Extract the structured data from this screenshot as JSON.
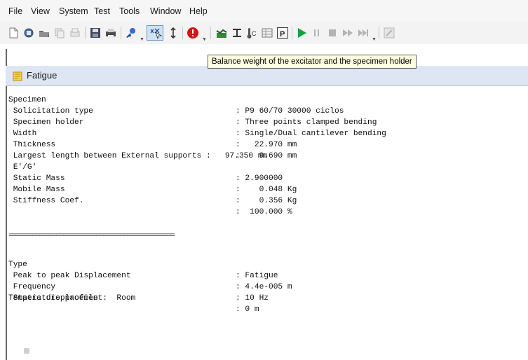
{
  "menu": [
    "File",
    "View",
    "System",
    "Test",
    "Tools",
    "Window",
    "Help"
  ],
  "toolbar": {
    "icons": [
      "new-icon",
      "open-icon",
      "browse-icon",
      "copy-icon",
      "print-preview-icon",
      "save-icon",
      "print-icon",
      "key-icon",
      "balance-weight-icon",
      "vertical-arrows-icon",
      "stop-icon",
      "chart-icon",
      "measure-icon",
      "temperature-icon",
      "table-icon",
      "parameters-icon",
      "play-icon",
      "pause-icon",
      "stop-square-icon",
      "fast-forward-icon",
      "skip-end-icon",
      "export-icon"
    ],
    "colors": {
      "stop": "#d21515",
      "play": "#14a33c",
      "chart": "#2d8a3a"
    }
  },
  "tooltip": "Balance weight of the excitator and the specimen holder",
  "window": {
    "title": "Fatigue"
  },
  "report": {
    "specimen": {
      "heading": "Specimen",
      "value": ": P9 60/70 30000 ciclos",
      "rows": [
        {
          "label": " Solicitation type",
          "value": ": Three points clamped bending"
        },
        {
          "label": " Specimen holder",
          "value": ": Single/Dual cantilever bending"
        },
        {
          "label": " Width",
          "value": ":   22.970 mm"
        },
        {
          "label": " Thickness",
          "value": ":    9.690 mm"
        },
        {
          "label": " Largest length between External supports :   97.350 mm",
          "value": ""
        },
        {
          "label": " E'/G'",
          "value": ": 2.900000"
        },
        {
          "label": " Static Mass",
          "value": ":    0.048 Kg"
        },
        {
          "label": " Mobile Mass",
          "value": ":    0.356 Kg"
        },
        {
          "label": " Stiffness Coef.",
          "value": ":  100.000 %"
        }
      ]
    },
    "divider": "=================================================",
    "test": {
      "heading": "Type",
      "value": ": Fatigue",
      "rows": [
        {
          "label": " Peak to peak Displacement",
          "value": ": 4.4e-005 m"
        },
        {
          "label": " Frequency",
          "value": ": 10 Hz"
        },
        {
          "label": " Static displacement",
          "value": ": 0 m"
        }
      ]
    },
    "temperature": {
      "label": "Temperature profile :  Room"
    }
  }
}
